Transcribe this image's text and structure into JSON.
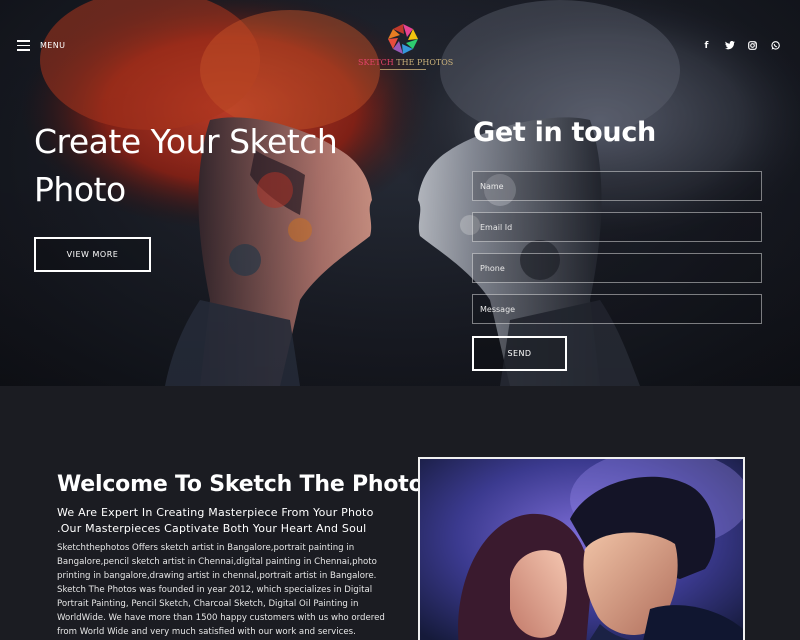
{
  "header": {
    "menu_label": "MENU",
    "logo": {
      "text_part1": "SKETCH",
      "text_part2": "THE PHOTOS"
    },
    "social_icons": [
      "facebook-icon",
      "twitter-icon",
      "instagram-icon",
      "whatsapp-icon"
    ]
  },
  "hero": {
    "title": "Create Your Sketch Photo",
    "button_label": "VIEW MORE"
  },
  "contact": {
    "title": "Get in touch",
    "name_placeholder": "Name",
    "email_placeholder": "Email Id",
    "phone_placeholder": "Phone",
    "message_placeholder": "Message",
    "send_label": "SEND"
  },
  "welcome": {
    "title": "Welcome To Sketch The Photos",
    "subtitle": "We Are Expert In Creating Masterpiece From Your Photo .Our Masterpieces Captivate Both Your Heart And Soul",
    "body": "Sketchthephotos Offers sketch artist in Bangalore,portrait painting in Bangalore,pencil sketch artist in Chennai,digital painting in Chennai,photo printing in bangalore,drawing artist in chennal,portrait artist in Bangalore. Sketch The Photos was founded in year 2012, which specializes in Digital Portrait Painting, Pencil Sketch, Charcoal Sketch, Digital Oil Painting in WorldWide. We have more than 1500 happy customers with us who ordered from World Wide and very much satisfied with our work and services."
  },
  "colors": {
    "background": "#1b1c22",
    "logo_pink": "#e4426a",
    "logo_gold": "#c9b07a"
  }
}
